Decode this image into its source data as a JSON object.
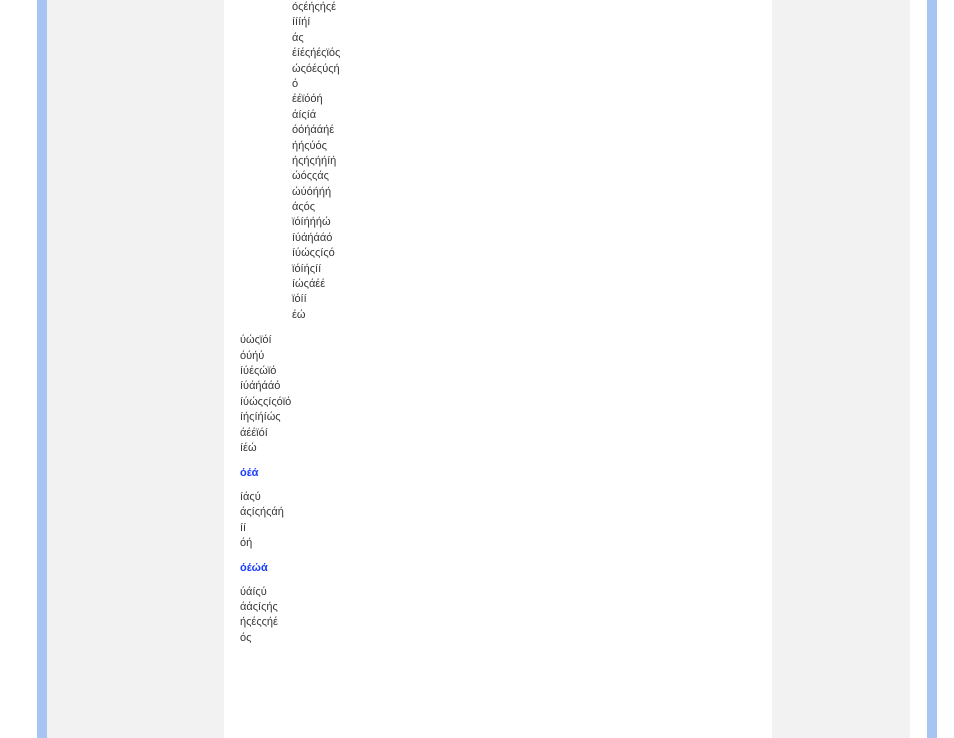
{
  "block1_indented": [
    "óςέήςήςέ",
    "íííήí",
    "άς",
    "έíέςήέςϊός",
    "ώςόέςύςή",
    "ό",
    "έέϊόόή",
    "άíςíά",
    "όόήάάήέ",
    "ήήςύός",
    "ήςήςήήíή",
    "ώόςςάς",
    "ώύόήήή",
    "άςός",
    "ϊόíήήήώ",
    "íύάήάάό",
    "íύώςςíςό",
    "ϊόíήςíí",
    "íώςάέέ",
    "ϊόíí",
    "έώ"
  ],
  "block2_flush": [
    "ύώςϊόí",
    "όύήύ",
    "íύέςώϊό",
    "íύάήάάό",
    "íύώςςíςόϊό",
    "íήςíήíώς",
    "άέέϊόí",
    "íέώ"
  ],
  "heading1": "όέά",
  "block3_flush": [
    "íάςύ",
    "άςíςήςάή",
    "íí",
    "όή"
  ],
  "heading2": "όέώά",
  "block4_flush": [
    "ύάíςύ",
    "άάςíςής",
    "ήςέςςήέ",
    "ός"
  ]
}
